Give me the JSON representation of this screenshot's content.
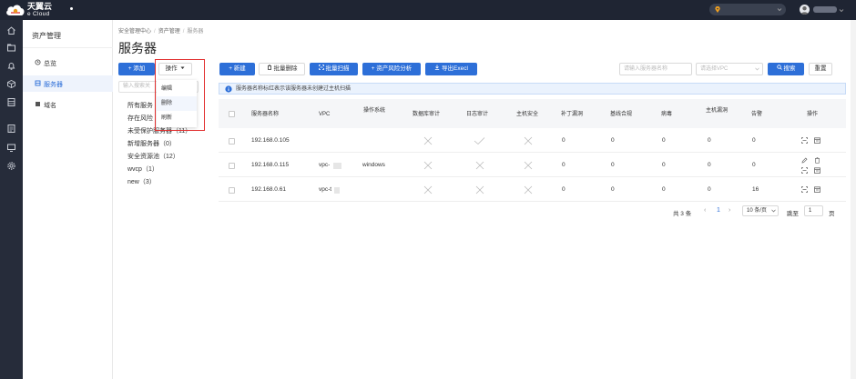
{
  "header": {
    "brand_cn": "天翼云",
    "brand_en": "e Cloud"
  },
  "sidebar": {
    "title": "资产管理",
    "items": [
      {
        "label": "总览",
        "active": false
      },
      {
        "label": "服务器",
        "active": true
      },
      {
        "label": "域名",
        "active": false
      }
    ]
  },
  "breadcrumb": {
    "items": [
      "安全管理中心",
      "资产管理",
      "服务器"
    ],
    "separator": "/"
  },
  "page_title": "服务器",
  "group_toolbar": {
    "add_label": "+ 添加",
    "ops_label": "操作"
  },
  "ops_menu": {
    "items": [
      "编辑",
      "删除",
      "刷新"
    ]
  },
  "group_panel": {
    "search_placeholder": "输入搜索关",
    "items": [
      "所有服务",
      "存在风险",
      "未受保护服务器（11）",
      "新增服务器（0）",
      "安全资源池（12）",
      "wvcp（1）",
      "new（3）"
    ]
  },
  "toolbar": {
    "new_label": "+ 新建",
    "batch_delete_label": "批量删除",
    "batch_scan_label": "批量扫描",
    "risk_analysis_label": "+ 资产风险分析",
    "export_label": "导出Execl",
    "search_placeholder": "请输入服务器名称",
    "vpc_placeholder": "请选择VPC",
    "search_label": "搜索",
    "reset_label": "重置"
  },
  "info_bar": {
    "text": "服务器名称标红表示该服务器未创建过主机扫描"
  },
  "table": {
    "columns": [
      "服务器名称",
      "VPC",
      "操作系统",
      "数据库审计",
      "日志审计",
      "主机安全",
      "补丁漏洞",
      "基线合规",
      "病毒",
      "主机漏洞",
      "告警",
      "操作"
    ],
    "rows": [
      {
        "ip": "192.168.0.105",
        "vpc": "",
        "os": "",
        "db_audit": "x",
        "log_audit": "check",
        "host_sec": "x",
        "patch": "0",
        "baseline": "0",
        "virus": "0",
        "host_vuln": "0",
        "alarm": "0"
      },
      {
        "ip": "192.168.0.115",
        "vpc": "vpc-",
        "os": "windows",
        "db_audit": "x",
        "log_audit": "x",
        "host_sec": "x",
        "patch": "0",
        "baseline": "0",
        "virus": "0",
        "host_vuln": "0",
        "alarm": "0"
      },
      {
        "ip": "192.168.0.61",
        "vpc": "vpc-t",
        "os": "",
        "db_audit": "x",
        "log_audit": "x",
        "host_sec": "x",
        "patch": "0",
        "baseline": "0",
        "virus": "0",
        "host_vuln": "0",
        "alarm": "16"
      }
    ]
  },
  "pager": {
    "total": "共 3 条",
    "current": "1",
    "page_size": "10 条/页",
    "goto_label": "跳至",
    "goto_value": "1",
    "page_unit": "页"
  },
  "colors": {
    "accent": "#2d6fd8",
    "topbar": "#1f2533",
    "highlight_box": "#e23232"
  }
}
